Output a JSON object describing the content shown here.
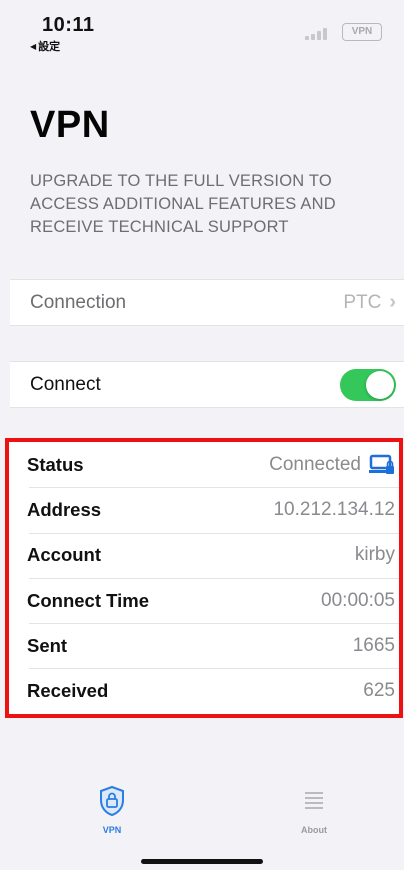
{
  "status_bar": {
    "time": "10:11",
    "back_label": "設定",
    "vpn_badge": "VPN"
  },
  "header": {
    "title": "VPN",
    "upgrade_text": "UPGRADE TO THE FULL VERSION TO ACCESS ADDITIONAL FEATURES AND RECEIVE TECHNICAL SUPPORT"
  },
  "connection": {
    "label": "Connection",
    "value": "PTC"
  },
  "connect": {
    "label": "Connect",
    "enabled": true,
    "toggle_color": "#34c759"
  },
  "info": {
    "status_label": "Status",
    "status_value": "Connected",
    "address_label": "Address",
    "address_value": "10.212.134.12",
    "account_label": "Account",
    "account_value": "kirby",
    "connect_time_label": "Connect Time",
    "connect_time_value": "00:00:05",
    "sent_label": "Sent",
    "sent_value": "1665",
    "received_label": "Received",
    "received_value": "625",
    "highlight_color": "#ee1111"
  },
  "tabbar": {
    "vpn_label": "VPN",
    "vpn_icon": "lock-shield-icon",
    "about_label": "About",
    "about_icon": "list-icon",
    "active_color": "#2a7de1"
  }
}
